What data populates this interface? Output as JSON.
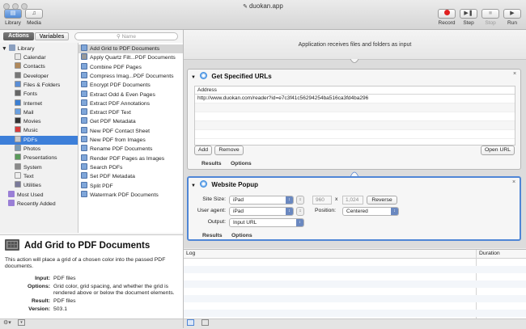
{
  "window": {
    "title": "duokan.app"
  },
  "toolbar": {
    "library": "Library",
    "media": "Media",
    "record": "Record",
    "step": "Step",
    "stop": "Stop",
    "run": "Run"
  },
  "tabs": {
    "actions": "Actions",
    "variables": "Variables"
  },
  "search": {
    "placeholder": "Name"
  },
  "library": {
    "root": "Library",
    "items": [
      {
        "label": "Calendar",
        "color": "#e8e8e8"
      },
      {
        "label": "Contacts",
        "color": "#b0885a"
      },
      {
        "label": "Developer",
        "color": "#777777"
      },
      {
        "label": "Files & Folders",
        "color": "#5a8ed6"
      },
      {
        "label": "Fonts",
        "color": "#666666"
      },
      {
        "label": "Internet",
        "color": "#3b7fd3"
      },
      {
        "label": "Mail",
        "color": "#6aa0e0"
      },
      {
        "label": "Movies",
        "color": "#333333"
      },
      {
        "label": "Music",
        "color": "#d83b3b"
      },
      {
        "label": "PDFs",
        "color": "#c9c9c9"
      },
      {
        "label": "Photos",
        "color": "#7a9bb5"
      },
      {
        "label": "Presentations",
        "color": "#5a9b5a"
      },
      {
        "label": "System",
        "color": "#8a8a8a"
      },
      {
        "label": "Text",
        "color": "#eeeeee"
      },
      {
        "label": "Utilities",
        "color": "#7a7a9a"
      }
    ],
    "extras": [
      {
        "label": "Most Used",
        "color": "#9a7fd6"
      },
      {
        "label": "Recently Added",
        "color": "#9a7fd6"
      }
    ]
  },
  "actions": [
    "Add Grid to PDF Documents",
    "Apply Quartz Filt...PDF Documents",
    "Combine PDF Pages",
    "Compress Imag...PDF Documents",
    "Encrypt PDF Documents",
    "Extract Odd & Even Pages",
    "Extract PDF Annotations",
    "Extract PDF Text",
    "Get PDF Metadata",
    "New PDF Contact Sheet",
    "New PDF from Images",
    "Rename PDF Documents",
    "Render PDF Pages as Images",
    "Search PDFs",
    "Set PDF Metadata",
    "Split PDF",
    "Watermark PDF Documents"
  ],
  "description": {
    "title": "Add Grid to PDF Documents",
    "summary": "This action will place a grid of a chosen color into the passed PDF documents.",
    "input_label": "Input:",
    "input": "PDF files",
    "options_label": "Options:",
    "options": "Grid color, grid spacing, and whether the grid is rendered above or below the document elements.",
    "result_label": "Result:",
    "result": "PDF files",
    "version_label": "Version:",
    "version": "503.1"
  },
  "workflow": {
    "receives": "Application receives files and folders as input",
    "get_urls": {
      "title": "Get Specified URLs",
      "column": "Address",
      "url": "http://www.duokan.com/reader?id=e7c3f41c56294254ba516ca3fd4ba296",
      "add": "Add",
      "remove": "Remove",
      "open_url": "Open URL",
      "results": "Results",
      "options": "Options"
    },
    "popup": {
      "title": "Website Popup",
      "site_size_label": "Site Size:",
      "site_size": "iPad",
      "width": "960",
      "times": "x",
      "height": "1,024",
      "reverse": "Reverse",
      "user_agent_label": "User agent:",
      "user_agent": "iPad",
      "position_label": "Position:",
      "position": "Centered",
      "output_label": "Output:",
      "output": "Input URL",
      "results": "Results",
      "options": "Options"
    }
  },
  "log": {
    "log_header": "Log",
    "duration_header": "Duration"
  }
}
